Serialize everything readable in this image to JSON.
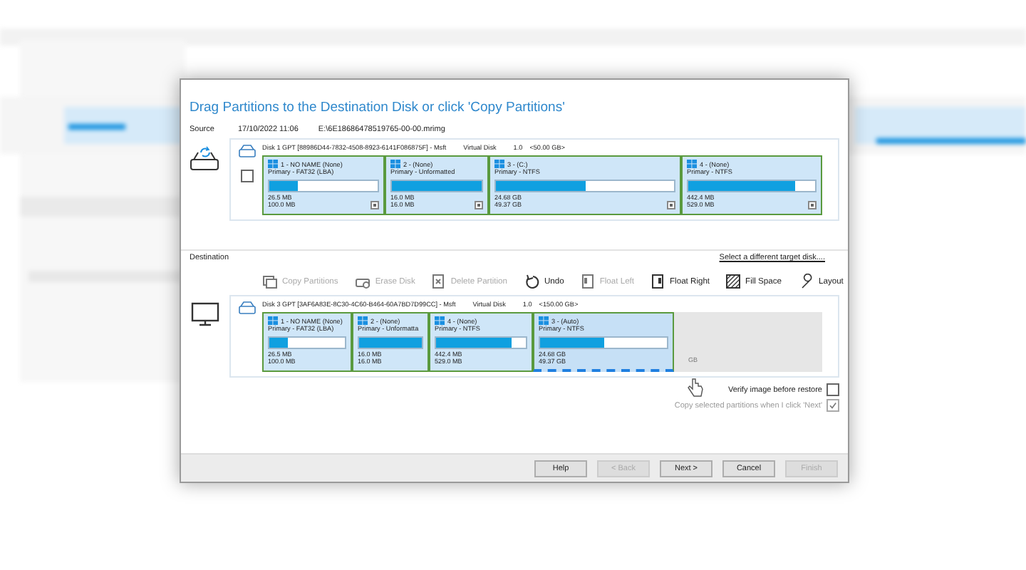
{
  "dialog": {
    "title": "Drag Partitions to the Destination Disk or click 'Copy Partitions'",
    "source": {
      "label": "Source",
      "date": "17/10/2022 11:06",
      "path": "E:\\6E18686478519765-00-00.mrimg",
      "checked": false,
      "disk": {
        "header": "Disk 1 GPT [88986D44-7832-4508-8923-6141F086875F] - Msft",
        "model": "Virtual Disk",
        "version": "1.0",
        "size": "<50.00 GB>"
      },
      "partitions": [
        {
          "name": "1 - NO NAME (None)",
          "type": "Primary - FAT32 (LBA)",
          "level": 0.26,
          "used": "26.5 MB",
          "total": "100.0 MB"
        },
        {
          "name": "2 - (None)",
          "type": "Primary - Unformatted",
          "level": 1,
          "used": "16.0 MB",
          "total": "16.0 MB"
        },
        {
          "name": "3 - (C:)",
          "type": "Primary - NTFS",
          "level": 0.5,
          "used": "24.68 GB",
          "total": "49.37 GB"
        },
        {
          "name": "4 - (None)",
          "type": "Primary - NTFS",
          "level": 0.84,
          "used": "442.4 MB",
          "total": "529.0 MB"
        }
      ]
    },
    "destination": {
      "label": "Destination",
      "link": "Select a different target disk....",
      "toolbar": [
        {
          "label": "Copy Partitions",
          "disabled": true
        },
        {
          "label": "Erase Disk",
          "disabled": true
        },
        {
          "label": "Delete Partition",
          "disabled": true
        },
        {
          "label": "Undo",
          "disabled": false
        },
        {
          "label": "Float Left",
          "disabled": true
        },
        {
          "label": "Float Right",
          "disabled": false
        },
        {
          "label": "Fill Space",
          "disabled": false
        },
        {
          "label": "Layout",
          "disabled": false
        }
      ],
      "disk": {
        "header": "Disk 3 GPT [3AF6A83E-8C30-4C60-B464-60A7BD7D99CC] - Msft",
        "model": "Virtual Disk",
        "version": "1.0",
        "size": "<150.00 GB>"
      },
      "partitions": [
        {
          "kind": "partition",
          "name": "1 - NO NAME (None)",
          "type": "Primary - FAT32 (LBA)",
          "level": 0.25,
          "used": "26.5 MB",
          "total": "100.0 MB",
          "selected": false
        },
        {
          "kind": "partition",
          "name": "2 - (None)",
          "type": "Primary - Unformatta",
          "level": 1,
          "used": "16.0 MB",
          "total": "16.0 MB",
          "selected": false
        },
        {
          "kind": "partition",
          "name": "4 - (None)",
          "type": "Primary - NTFS",
          "level": 0.84,
          "used": "442.4 MB",
          "total": "529.0 MB",
          "selected": false
        },
        {
          "kind": "partition",
          "name": "3 - (Auto)",
          "type": "Primary - NTFS",
          "level": 0.5,
          "used": "24.68 GB",
          "total": "49.37 GB",
          "selected": true
        },
        {
          "kind": "unallocated",
          "total": "GB"
        }
      ]
    },
    "options": [
      {
        "label": "Verify image before restore",
        "checked": false,
        "disabled": false
      },
      {
        "label": "Copy selected partitions when I click 'Next'",
        "checked": true,
        "disabled": true
      }
    ],
    "buttons": [
      {
        "label": "Help",
        "disabled": false
      },
      {
        "label": "< Back",
        "disabled": true
      },
      {
        "label": "Next >",
        "disabled": false
      },
      {
        "label": "Cancel",
        "disabled": false
      },
      {
        "label": "Finish",
        "disabled": true
      }
    ]
  }
}
